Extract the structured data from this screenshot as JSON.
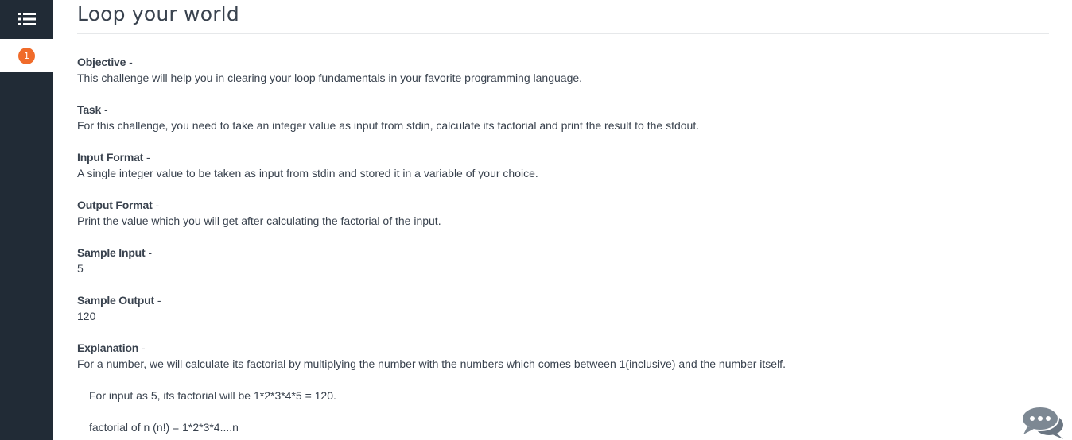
{
  "sidebar": {
    "question_number": "1"
  },
  "problem": {
    "title": "Loop your world",
    "sections": [
      {
        "heading": "Objective",
        "dash": " -",
        "body": "This challenge will help you in clearing your loop fundamentals in your favorite programming language."
      },
      {
        "heading": "Task",
        "dash": " -",
        "body": "For this challenge, you need to take an integer value as input from stdin, calculate its factorial and print the result to the stdout."
      },
      {
        "heading": "Input Format",
        "dash": " -",
        "body": "A single integer value to be taken as input from stdin and stored it in a variable of your choice."
      },
      {
        "heading": "Output Format",
        "dash": " -",
        "body": "Print the value which you will get after calculating the factorial of the input."
      },
      {
        "heading": "Sample Input",
        "dash": " -",
        "body": "5"
      },
      {
        "heading": "Sample Output",
        "dash": " -",
        "body": "120"
      },
      {
        "heading": "Explanation",
        "dash": " -",
        "body": "For a number, we will calculate its factorial by multiplying the number with the numbers which comes between 1(inclusive) and the number itself."
      }
    ],
    "explanation_lines": [
      "For input as 5, its factorial will be 1*2*3*4*5 = 120.",
      "factorial of n (n!) = 1*2*3*4....n"
    ]
  },
  "icons": {
    "menu": "list-menu-icon",
    "chat": "chat-bubbles-icon"
  },
  "colors": {
    "sidebar": "#212b36",
    "badge": "#f06b2a",
    "text": "#39424e"
  }
}
